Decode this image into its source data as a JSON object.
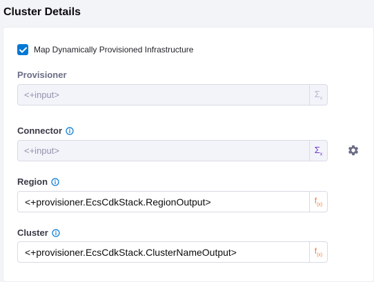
{
  "section": {
    "title": "Cluster Details"
  },
  "checkbox": {
    "label": "Map Dynamically Provisioned Infrastructure",
    "checked": true
  },
  "fields": {
    "provisioner": {
      "label": "Provisioner",
      "value": "<+input>"
    },
    "connector": {
      "label": "Connector",
      "value": "<+input>"
    },
    "region": {
      "label": "Region",
      "value": "<+provisioner.EcsCdkStack.RegionOutput>"
    },
    "cluster": {
      "label": "Cluster",
      "value": "<+provisioner.EcsCdkStack.ClusterNameOutput>"
    }
  },
  "icons": {
    "checkbox": "check-icon",
    "info": "info-icon",
    "runtime": "sigma-icon",
    "expression": "fx-icon",
    "settings": "gear-icon"
  },
  "colors": {
    "accent": "#0278d5",
    "runtime_active": "#6938c0",
    "expression": "#ef7b32"
  }
}
